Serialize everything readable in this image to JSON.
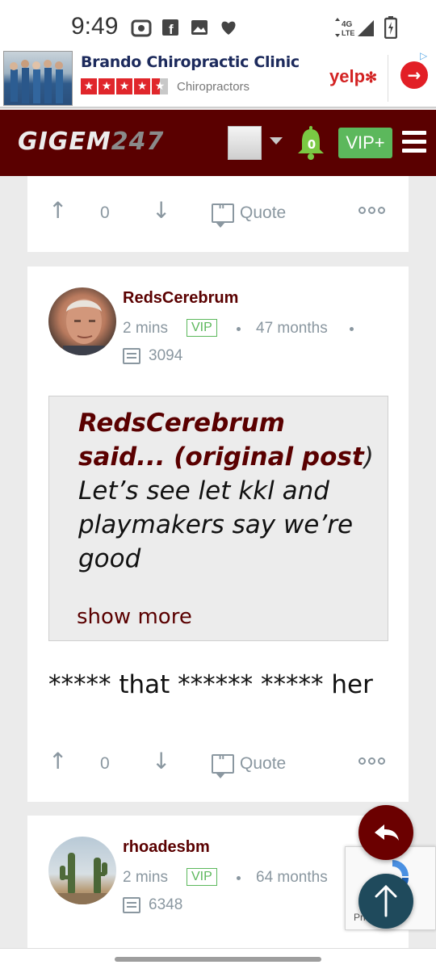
{
  "status_bar": {
    "time": "9:49",
    "network": "4G LTE",
    "icons": [
      "screen-record-icon",
      "facebook-icon",
      "gallery-icon",
      "heart-icon",
      "data-arrows-icon",
      "signal-icon",
      "battery-icon"
    ]
  },
  "ad": {
    "business_name": "Brando Chiropractic Clinic",
    "rating_stars": 4.5,
    "category": "Chiropractors",
    "brand": "yelp",
    "cta_icon": "arrow-right-icon"
  },
  "header": {
    "logo_text": "GIGEM",
    "logo_number": "247",
    "notification_count": "0",
    "vip_label": "VIP+",
    "colors": {
      "bar": "#5a0000",
      "vip": "#5cb85c"
    }
  },
  "previous_post": {
    "vote_count": "0",
    "quote_label": "Quote"
  },
  "post": {
    "author": "RedsCerebrum",
    "time_ago": "2 mins",
    "badge": "VIP",
    "member_age": "47 months",
    "post_count": "3094",
    "quote": {
      "author_line": "RedsCerebrum said... (",
      "original_post": "original post",
      "close": ")",
      "text": "Let’s see let kkl and playmakers say we’re good",
      "show_more": "show more"
    },
    "body": "***** that ****** ***** her",
    "vote_count": "0",
    "quote_label": "Quote"
  },
  "next_post": {
    "author": "rhoadesbm",
    "time_ago": "2 mins",
    "badge": "VIP",
    "member_age": "64 months",
    "post_count": "6348"
  },
  "recaptcha": {
    "text": "Privacy - Terms",
    "visible_text": "Pri          erms"
  }
}
